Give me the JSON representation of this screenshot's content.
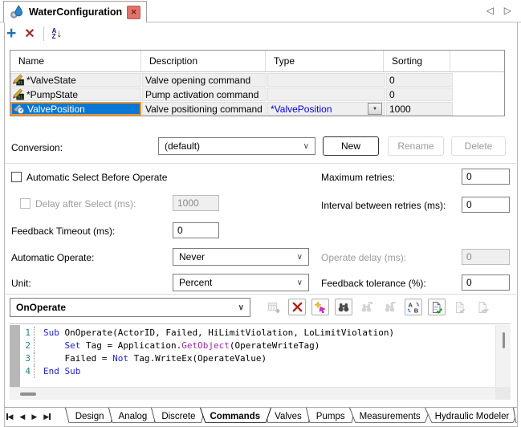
{
  "window": {
    "tab_title": "WaterConfiguration",
    "icons": {
      "tab": "water-config-icon",
      "close": "✕",
      "nav_back": "◁",
      "nav_forward": "▷"
    }
  },
  "toolbar": {
    "add_glyph": "+",
    "delete_glyph": "✕",
    "sort_letter_a": "A",
    "sort_letter_z": "Z",
    "sort_arrow": "↓"
  },
  "table": {
    "columns": [
      {
        "label": "Name"
      },
      {
        "label": "Description"
      },
      {
        "label": "Type"
      },
      {
        "label": "Sorting"
      }
    ],
    "rows": [
      {
        "icon": "digital-command-icon",
        "name": "*ValveState",
        "description": "Valve opening command",
        "type": "",
        "type_has_dropdown": false,
        "sorting": "0",
        "selected": false
      },
      {
        "icon": "digital-command-icon",
        "name": "*PumpState",
        "description": "Pump activation command",
        "type": "",
        "type_has_dropdown": false,
        "sorting": "0",
        "selected": false
      },
      {
        "icon": "analog-command-icon",
        "name": "ValvePosition",
        "description": "Valve positioning command",
        "type": "*ValvePosition",
        "type_has_dropdown": true,
        "sorting": "1000",
        "selected": true
      }
    ],
    "dropdown_arrow": "▼"
  },
  "conversion": {
    "label": "Conversion:",
    "value": "(default)",
    "buttons": [
      {
        "label": "New",
        "enabled": true
      },
      {
        "label": "Rename",
        "enabled": false
      },
      {
        "label": "Delete",
        "enabled": false
      }
    ]
  },
  "options": {
    "auto_select": {
      "label": "Automatic Select Before Operate",
      "checked": false,
      "enabled": true
    },
    "delay_after_select": {
      "label": "Delay after Select (ms):",
      "value": "1000",
      "checked": false,
      "enabled": false
    },
    "feedback_timeout": {
      "label": "Feedback Timeout (ms):",
      "value": "0"
    },
    "automatic_operate": {
      "label": "Automatic Operate:",
      "value": "Never"
    },
    "unit": {
      "label": "Unit:",
      "value": "Percent"
    },
    "maximum_retries": {
      "label": "Maximum retries:",
      "value": "0"
    },
    "interval_retries": {
      "label": "Interval between retries (ms):",
      "value": "0"
    },
    "operate_delay": {
      "label": "Operate delay (ms):",
      "value": "0",
      "enabled": false
    },
    "feedback_tolerance": {
      "label": "Feedback tolerance (%):",
      "value": "0"
    }
  },
  "script": {
    "event_selector_value": "OnOperate",
    "toolbar": [
      {
        "name": "insert-script-icon",
        "enabled": false
      },
      {
        "name": "delete-script-icon",
        "enabled": true
      },
      {
        "name": "goto-icon",
        "enabled": true
      },
      {
        "name": "find-icon",
        "enabled": true
      },
      {
        "name": "find-next-icon",
        "enabled": false
      },
      {
        "name": "find-previous-icon",
        "enabled": false
      },
      {
        "name": "replace-icon",
        "enabled": true
      },
      {
        "name": "validate-icon",
        "enabled": true
      },
      {
        "name": "validate-next-icon",
        "enabled": false
      },
      {
        "name": "validate-all-icon",
        "enabled": false
      }
    ],
    "code": {
      "lines": [
        {
          "number": "1",
          "segments": [
            {
              "text": "Sub",
              "style": "keyword"
            },
            {
              "text": " OnOperate(ActorID, Failed, HiLimitViolation, LoLimitViolation)",
              "style": "plain"
            }
          ]
        },
        {
          "number": "2",
          "segments": [
            {
              "text": "    ",
              "style": "plain"
            },
            {
              "text": "Set",
              "style": "keyword"
            },
            {
              "text": " Tag = Application.",
              "style": "plain"
            },
            {
              "text": "GetObject",
              "style": "function"
            },
            {
              "text": "(OperateWriteTag)",
              "style": "plain"
            }
          ]
        },
        {
          "number": "3",
          "segments": [
            {
              "text": "    Failed = ",
              "style": "plain"
            },
            {
              "text": "Not",
              "style": "keyword"
            },
            {
              "text": " Tag.WriteEx(OperateValue)",
              "style": "plain"
            }
          ]
        },
        {
          "number": "4",
          "segments": [
            {
              "text": "End Sub",
              "style": "keyword"
            }
          ]
        }
      ]
    }
  },
  "bottom_tabs": {
    "nav_icons": [
      "first",
      "previous",
      "next",
      "last"
    ],
    "tabs": [
      {
        "label": "Design",
        "active": false
      },
      {
        "label": "Analog",
        "active": false
      },
      {
        "label": "Discrete",
        "active": false
      },
      {
        "label": "Commands",
        "active": true
      },
      {
        "label": "Valves",
        "active": false
      },
      {
        "label": "Pumps",
        "active": false
      },
      {
        "label": "Measurements",
        "active": false
      },
      {
        "label": "Hydraulic Modeler",
        "active": false
      }
    ]
  },
  "colors": {
    "selection_blue": "#0a77d4",
    "selection_focus_orange": "#e8962e",
    "keyword_blue": "#2222cc",
    "function_magenta": "#992d99",
    "line_number_teal": "#1f8080",
    "type_link_blue": "#0000dd",
    "close_button_red": "#e0736c"
  }
}
